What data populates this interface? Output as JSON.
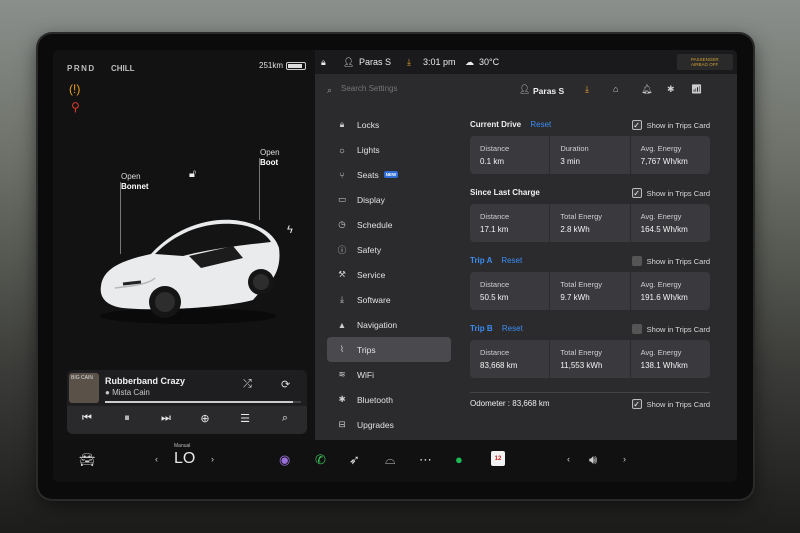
{
  "vehicle": {
    "gear": "PRND",
    "drive_mode": "CHILL",
    "range": "251km",
    "open_bonnet": [
      "Open",
      "Bonnet"
    ],
    "open_boot": [
      "Open",
      "Boot"
    ]
  },
  "status_bar": {
    "profile": "Paras S",
    "time": "3:01 pm",
    "temperature": "30°C",
    "airbag_label": "PASSENGER AIRBAG OFF"
  },
  "header": {
    "search_placeholder": "Search Settings",
    "profile": "Paras S"
  },
  "sidebar": {
    "items": [
      {
        "label": "Locks",
        "icon": "lock-icon"
      },
      {
        "label": "Lights",
        "icon": "light-icon"
      },
      {
        "label": "Seats",
        "icon": "seat-icon",
        "badge": "NEW"
      },
      {
        "label": "Display",
        "icon": "display-icon"
      },
      {
        "label": "Schedule",
        "icon": "clock-icon"
      },
      {
        "label": "Safety",
        "icon": "safety-icon"
      },
      {
        "label": "Service",
        "icon": "wrench-icon"
      },
      {
        "label": "Software",
        "icon": "download-icon"
      },
      {
        "label": "Navigation",
        "icon": "navigation-icon"
      },
      {
        "label": "Trips",
        "icon": "trips-icon",
        "active": true
      },
      {
        "label": "WiFi",
        "icon": "wifi-icon"
      },
      {
        "label": "Bluetooth",
        "icon": "bluetooth-icon"
      },
      {
        "label": "Upgrades",
        "icon": "upgrades-icon"
      }
    ]
  },
  "trips": {
    "show_label": "Show in Trips Card",
    "reset_label": "Reset",
    "current_drive": {
      "title": "Current Drive",
      "show_checked": true,
      "stats": [
        {
          "label": "Distance",
          "value": "0.1 km"
        },
        {
          "label": "Duration",
          "value": "3 min"
        },
        {
          "label": "Avg. Energy",
          "value": "7,767 Wh/km"
        }
      ]
    },
    "since_last_charge": {
      "title": "Since Last Charge",
      "show_checked": true,
      "stats": [
        {
          "label": "Distance",
          "value": "17.1 km"
        },
        {
          "label": "Total Energy",
          "value": "2.8 kWh"
        },
        {
          "label": "Avg. Energy",
          "value": "164.5 Wh/km"
        }
      ]
    },
    "trip_a": {
      "title": "Trip A",
      "show_checked": false,
      "stats": [
        {
          "label": "Distance",
          "value": "50.5 km"
        },
        {
          "label": "Total Energy",
          "value": "9.7 kWh"
        },
        {
          "label": "Avg. Energy",
          "value": "191.6 Wh/km"
        }
      ]
    },
    "trip_b": {
      "title": "Trip B",
      "show_checked": false,
      "stats": [
        {
          "label": "Distance",
          "value": "83,668 km"
        },
        {
          "label": "Total Energy",
          "value": "11,553 kWh"
        },
        {
          "label": "Avg. Energy",
          "value": "138.1 Wh/km"
        }
      ]
    },
    "odometer": {
      "label": "Odometer :  83,668 km",
      "show_checked": true
    }
  },
  "media": {
    "title": "Rubberband Crazy",
    "artist": "Mista Cain",
    "album_art_text": "BIG CAIN",
    "progress": 0.96
  },
  "dock": {
    "climate_mode": "Manual",
    "temperature": "LO",
    "calendar_day": "12"
  },
  "colors": {
    "accent": "#3c8cf0",
    "panel": "#2b2b2e",
    "card": "#3a3a3e",
    "warning": "#e6a020",
    "alert": "#d83a2a"
  }
}
